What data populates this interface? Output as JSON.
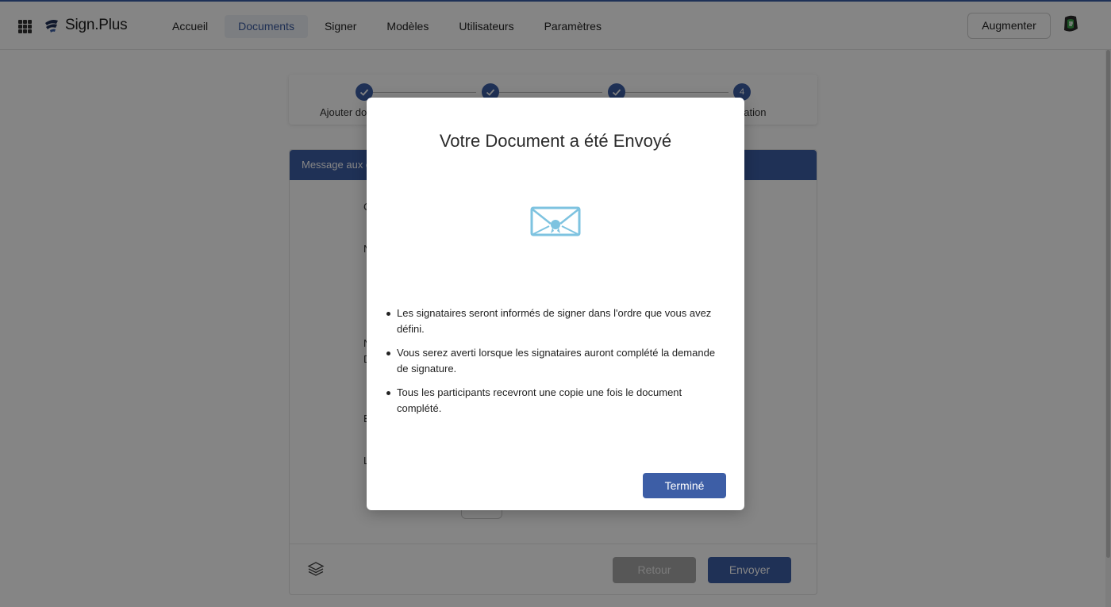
{
  "brand": {
    "name": "Sign.Plus"
  },
  "nav": {
    "items": [
      {
        "label": "Accueil",
        "active": false
      },
      {
        "label": "Documents",
        "active": true
      },
      {
        "label": "Signer",
        "active": false
      },
      {
        "label": "Modèles",
        "active": false
      },
      {
        "label": "Utilisateurs",
        "active": false
      },
      {
        "label": "Paramètres",
        "active": false
      }
    ],
    "upgrade_label": "Augmenter"
  },
  "stepper": {
    "steps": [
      {
        "state": "done",
        "label": "Ajouter do"
      },
      {
        "state": "done",
        "label": ""
      },
      {
        "state": "done",
        "label": ""
      },
      {
        "state": "current",
        "number": "4",
        "label": "nation"
      }
    ]
  },
  "form": {
    "header_label": "Message aux c",
    "letters": [
      "C",
      "N",
      "N",
      "D",
      "E",
      "L"
    ],
    "back_label": "Retour",
    "send_label": "Envoyer"
  },
  "modal": {
    "title": "Votre Document a été Envoyé",
    "bullets": [
      "Les signataires seront informés de signer dans l'ordre que vous avez défini.",
      "Vous serez averti lorsque les signataires auront complété la demande de signature.",
      "Tous les participants recevront une copie une fois le document complété."
    ],
    "done_label": "Terminé"
  },
  "icons": {
    "apps": "apps-grid-icon",
    "avatar": "user-avatar-icon",
    "step_done": "check-icon",
    "layers": "layers-icon",
    "envelope": "envelope-seal-icon"
  },
  "colors": {
    "accent": "#3d5ea6",
    "envelope": "#7ec3e0"
  }
}
